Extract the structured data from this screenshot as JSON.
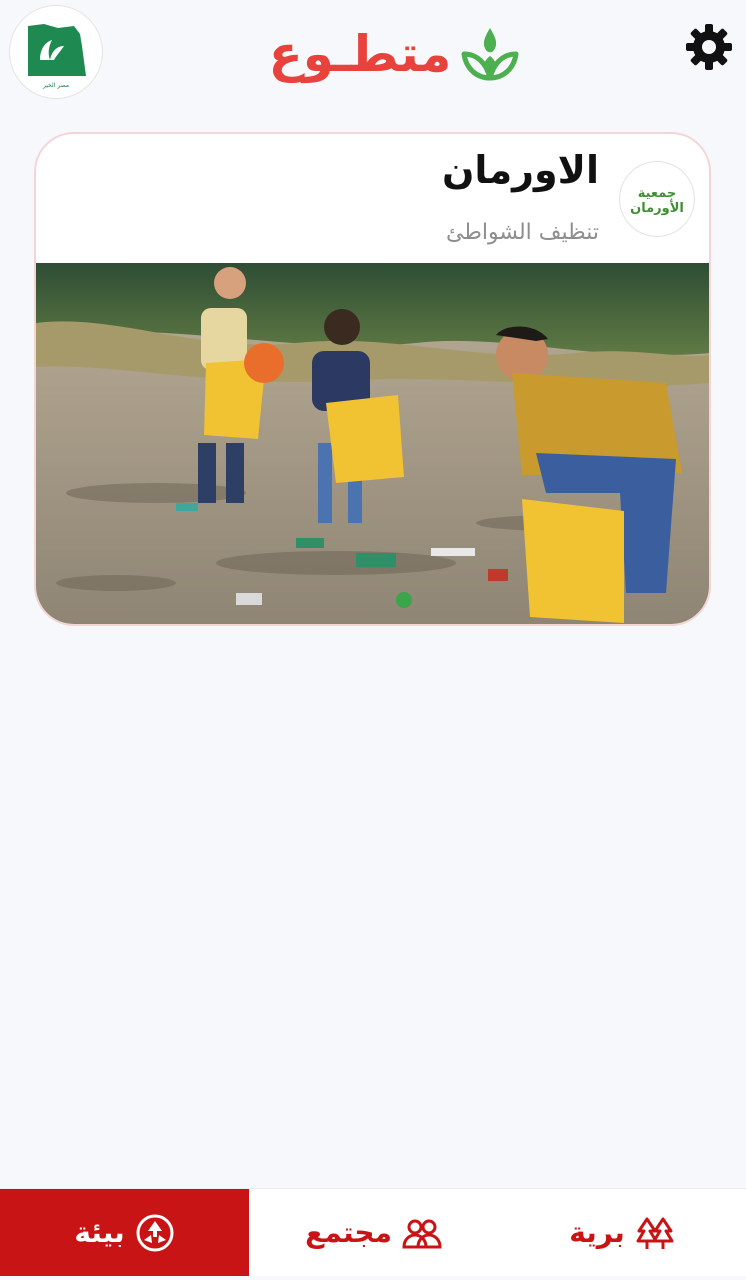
{
  "header": {
    "app_title": "متطـوع",
    "org_logo_caption": "مصر الخير",
    "settings_icon": "gear-icon",
    "brand_icon": "leaf-drop-icon"
  },
  "card": {
    "title": "الاورمان",
    "subtitle": "تنظيف الشواطئ",
    "org_logo_text": "جمعية الأورمان",
    "photo_description_icon": "beach-cleanup-photo"
  },
  "bottom_nav": {
    "tabs": [
      {
        "label": "برية",
        "icon": "trees-icon",
        "active": false
      },
      {
        "label": "مجتمع",
        "icon": "people-icon",
        "active": false
      },
      {
        "label": "بيئة",
        "icon": "recycle-icon",
        "active": true
      }
    ]
  },
  "colors": {
    "accent": "#c81414",
    "brand_red": "#e8423c",
    "brand_green": "#4caf50",
    "background": "#f7f8fb"
  }
}
